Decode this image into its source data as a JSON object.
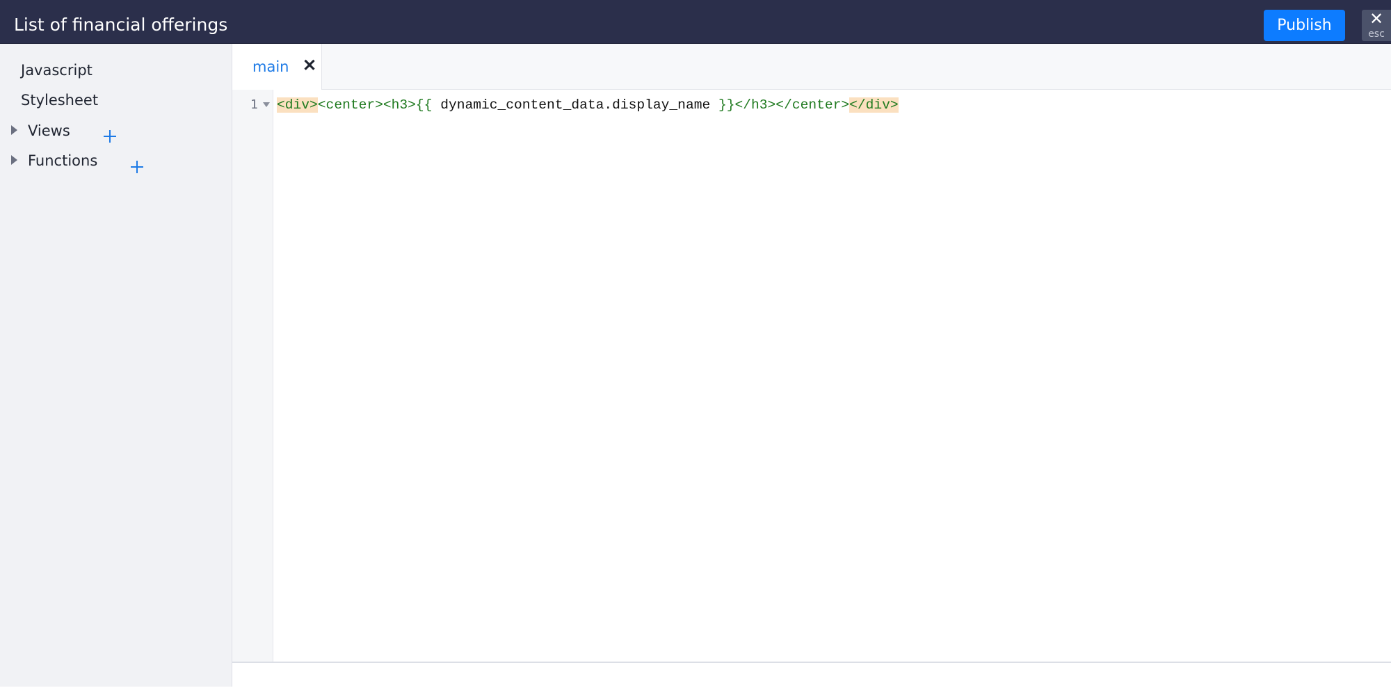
{
  "header": {
    "title": "List of financial offerings",
    "publish_label": "Publish",
    "close_glyph": "✕",
    "close_hint": "esc"
  },
  "sidebar": {
    "items": [
      {
        "label": "Javascript"
      },
      {
        "label": "Stylesheet"
      }
    ],
    "tree": [
      {
        "label": "Views",
        "icon": "caret-right-icon",
        "action_icon": "plus-icon"
      },
      {
        "label": "Functions",
        "icon": "caret-right-icon",
        "action_icon": "plus-icon"
      }
    ]
  },
  "tabs": [
    {
      "label": "main",
      "active": true,
      "close_glyph": "✕"
    }
  ],
  "editor": {
    "line_numbers": [
      "1"
    ],
    "line1": {
      "open_div": "<div>",
      "open_center_h3": "<center><h3>",
      "brace_open": "{{",
      "expression": " dynamic_content_data.display_name ",
      "brace_close": "}}",
      "close_h3_center": "</h3></center>",
      "close_div": "</div>"
    }
  },
  "colors": {
    "header_bg": "#2b2f4b",
    "accent": "#0d7cff",
    "tag_green": "#1f7a1f",
    "match_highlight": "#fbe0c0"
  }
}
